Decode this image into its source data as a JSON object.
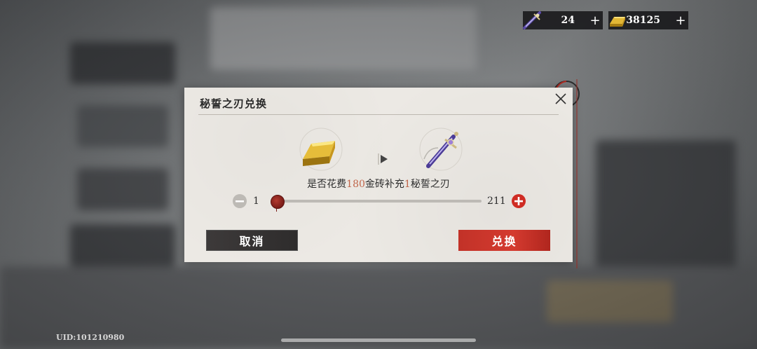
{
  "currencies": {
    "blade": {
      "icon": "dagger-icon",
      "amount": "24",
      "plus": "+"
    },
    "gold": {
      "icon": "gold-bar-icon",
      "amount": "38125",
      "plus": "+"
    }
  },
  "dialog": {
    "title": "秘誓之刃兑换",
    "close_icon": "close-icon",
    "from_item_icon": "gold-bar-icon",
    "to_item_icon": "dagger-icon",
    "arrow_icon": "play-arrow-icon",
    "prompt": {
      "part1": "是否花费",
      "cost": "180",
      "part2": "金砖补充",
      "count": "1",
      "part3": "秘誓之刃"
    },
    "slider": {
      "min_label": "1",
      "max_label": "211",
      "value": 1,
      "min": 1,
      "max": 211
    },
    "cancel_label": "取消",
    "confirm_label": "兑换"
  },
  "footer": {
    "uid": "UID:101210980"
  },
  "colors": {
    "accent_red": "#c23228",
    "highlight": "#c0664a",
    "dark_button": "#3d3a3a"
  }
}
